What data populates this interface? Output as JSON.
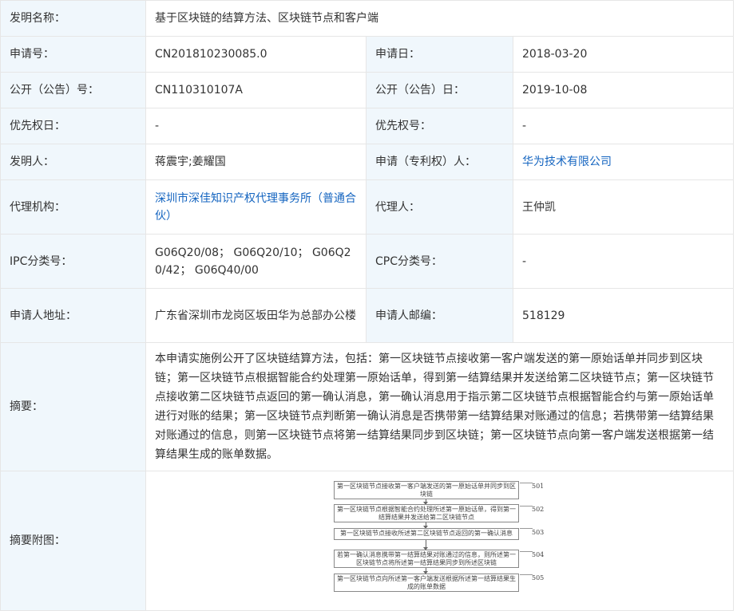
{
  "rows": {
    "title": {
      "label": "发明名称：",
      "value": "基于区块链的结算方法、区块链节点和客户端"
    },
    "app_no": {
      "label": "申请号：",
      "value": "CN201810230085.0"
    },
    "app_date": {
      "label": "申请日：",
      "value": "2018-03-20"
    },
    "pub_no": {
      "label": "公开（公告）号：",
      "value": "CN110310107A"
    },
    "pub_date": {
      "label": "公开（公告）日：",
      "value": "2019-10-08"
    },
    "priority_date": {
      "label": "优先权日：",
      "value": "-"
    },
    "priority_no": {
      "label": "优先权号：",
      "value": "-"
    },
    "inventor": {
      "label": "发明人：",
      "value": "蒋震宇;姜耀国"
    },
    "applicant": {
      "label": "申请（专利权）人：",
      "value": "华为技术有限公司"
    },
    "agency": {
      "label": "代理机构：",
      "value": "深圳市深佳知识产权代理事务所（普通合伙）"
    },
    "agent": {
      "label": "代理人：",
      "value": "王仲凯"
    },
    "ipc": {
      "label": "IPC分类号：",
      "value": "G06Q20/08； G06Q20/10； G06Q20/42； G06Q40/00"
    },
    "cpc": {
      "label": "CPC分类号：",
      "value": "-"
    },
    "address": {
      "label": "申请人地址：",
      "value": "广东省深圳市龙岗区坂田华为总部办公楼"
    },
    "postcode": {
      "label": "申请人邮编：",
      "value": "518129"
    },
    "abstract": {
      "label": "摘要：",
      "value": "本申请实施例公开了区块链结算方法，包括：第一区块链节点接收第一客户端发送的第一原始话单并同步到区块链；第一区块链节点根据智能合约处理第一原始话单，得到第一结算结果并发送给第二区块链节点；第一区块链节点接收第二区块链节点返回的第一确认消息，第一确认消息用于指示第二区块链节点根据智能合约与第一原始话单进行对账的结果；第一区块链节点判断第一确认消息是否携带第一结算结果对账通过的信息；若携带第一结算结果对账通过的信息，则第一区块链节点将第一结算结果同步到区块链；第一区块链节点向第一客户端发送根据第一结算结果生成的账单数据。"
    },
    "figure": {
      "label": "摘要附图："
    }
  },
  "flowchart": {
    "steps": [
      {
        "text": "第一区块链节点接收第一客户端发送的第一原始话单并同步到区块链",
        "num": "501"
      },
      {
        "text": "第一区块链节点根据智能合约处理所述第一原始话单，得到第一结算结果并发送给第二区块链节点",
        "num": "502"
      },
      {
        "text": "第一区块链节点接收所述第二区块链节点返回的第一确认消息",
        "num": "503"
      },
      {
        "text": "若第一确认消息携带第一结算结果对账通过的信息，则所述第一区块链节点将所述第一结算结果同步到所述区块链",
        "num": "504"
      },
      {
        "text": "第一区块链节点向所述第一客户端发送根据所述第一结算结果生成的账单数据",
        "num": "505"
      }
    ]
  }
}
